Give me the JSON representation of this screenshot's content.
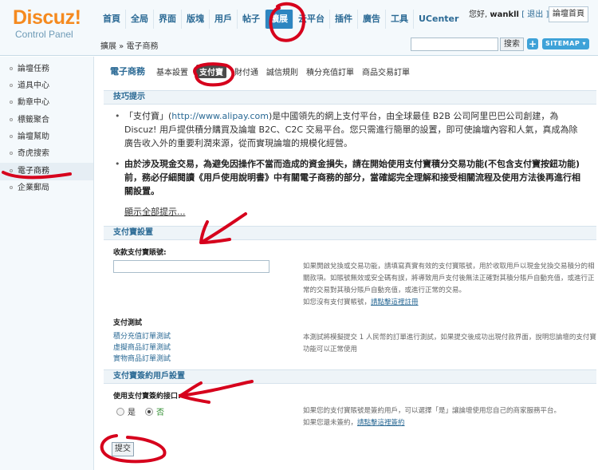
{
  "logo": {
    "main": "Discuz!",
    "sub": "Control Panel"
  },
  "nav": [
    "首頁",
    "全局",
    "界面",
    "版塊",
    "用戶",
    "帖子",
    "擴展",
    "云平台",
    "插件",
    "廣告",
    "工具",
    "UCenter"
  ],
  "nav_active": "擴展",
  "user": {
    "greeting": "您好,",
    "name": "wankll",
    "logout": "[ 退出 ]",
    "home": "論壇首頁"
  },
  "breadcrumb": "擴展 » 電子商務",
  "search": {
    "button": "搜索",
    "plus": "+",
    "sitemap": "SITEMAP ▾"
  },
  "sidebar": [
    "論壇任務",
    "道具中心",
    "勳章中心",
    "標籤聚合",
    "論壇幫助",
    "奇虎搜索",
    "電子商務",
    "企業郵局"
  ],
  "sidebar_active": "電子商務",
  "tabs": {
    "title": "電子商務",
    "items": [
      "基本設置",
      "支付寶",
      "財付通",
      "誠信規則",
      "積分充值訂單",
      "商品交易訂單"
    ],
    "active": "支付寶"
  },
  "tips": {
    "header": "技巧提示",
    "tip1_pre": "「支付寶」(",
    "tip1_link": "http://www.alipay.com",
    "tip1_post": ")是中國領先的網上支付平台，由全球最佳 B2B 公司阿里巴巴公司創建，為 Discuz! 用戶提供積分購買及論壇 B2C、C2C 交易平台。您只需進行簡單的設置，即可使論壇內容和人氣，真成為除廣告收入外的重要利潤來源，從而實現論壇的規模化經營。",
    "tip2": "由於涉及現金交易，為避免因操作不當而造成的資金損失，請在開始使用支付寶積分交易功能(不包含支付寶按鈕功能)前，務必仔細閱讀《用戶使用說明書》中有關電子商務的部分，當確認完全理解和接受相關流程及使用方法後再進行相關設置。",
    "show_all": "顯示全部提示..."
  },
  "alipay_settings": {
    "header": "支付寶設置",
    "account_label": "收款支付寶賬號:",
    "account_value": "",
    "account_help": "如果開啟兌換或交易功能，請填寫真實有效的支付寶賬號，用於收取用戶以現金兌換交易積分的相關款項。如賬號無效或安全碼有誤，將導致用戶支付後無法正確對其積分賬戶自動充值，或進行正常的交易對其積分賬戶自動充值，或進行正常的交易。",
    "account_help2": "如您沒有支付寶帳號，",
    "account_help_link": "請點擊這裡註冊",
    "test_label": "支付測試",
    "test_links": [
      "積分充值訂單測試",
      "虛擬商品訂單測試",
      "實物商品訂單測試"
    ],
    "test_help": "本測試將模擬提交 1 人民幣的訂單進行測試，如果提交後成功出現付款界面，說明您論壇的支付寶功能可以正常使用"
  },
  "contract": {
    "header": "支付寶簽約用戶設置",
    "label": "使用支付寶簽約接口:",
    "options": [
      "是",
      "否"
    ],
    "selected": "否",
    "help": "如果您的支付寶賬號是簽約用戶，可以選擇「是」讓論壇使用您自己的商家服務平台。",
    "help2": "如果您還未簽約，",
    "help_link": "請點擊這裡簽約"
  },
  "submit": "提交",
  "colors": {
    "accent": "#2e86c1",
    "logo": "#f58a1f",
    "annotation": "#d6001c"
  }
}
